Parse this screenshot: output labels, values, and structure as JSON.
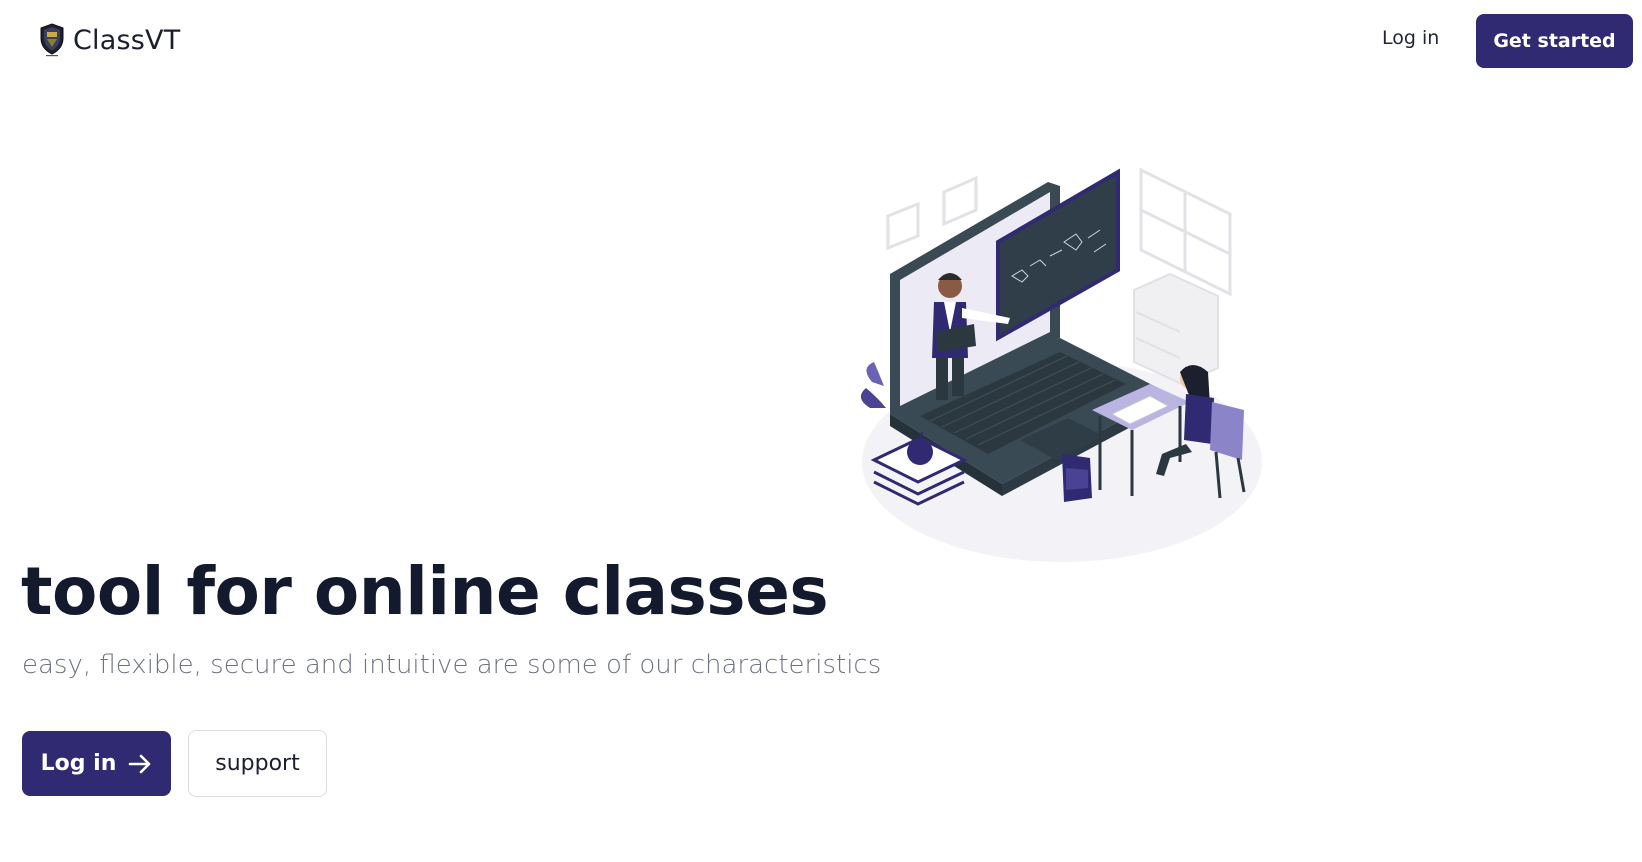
{
  "header": {
    "brand_name": "ClassVT",
    "login_label": "Log in",
    "cta_label": "Get started"
  },
  "hero": {
    "title": "tool for online classes",
    "subtitle": "easy, flexible, secure and intuitive are some of our characteristics",
    "primary_button": {
      "label": "Log in",
      "icon": "arrow-right-icon"
    },
    "secondary_button": {
      "label": "support"
    },
    "illustration": "online-class-laptop-illustration"
  },
  "colors": {
    "brand": "#302a72",
    "text_dark": "#141a2e",
    "text_muted": "#6f7380",
    "accent_light": "#8b84c9"
  }
}
